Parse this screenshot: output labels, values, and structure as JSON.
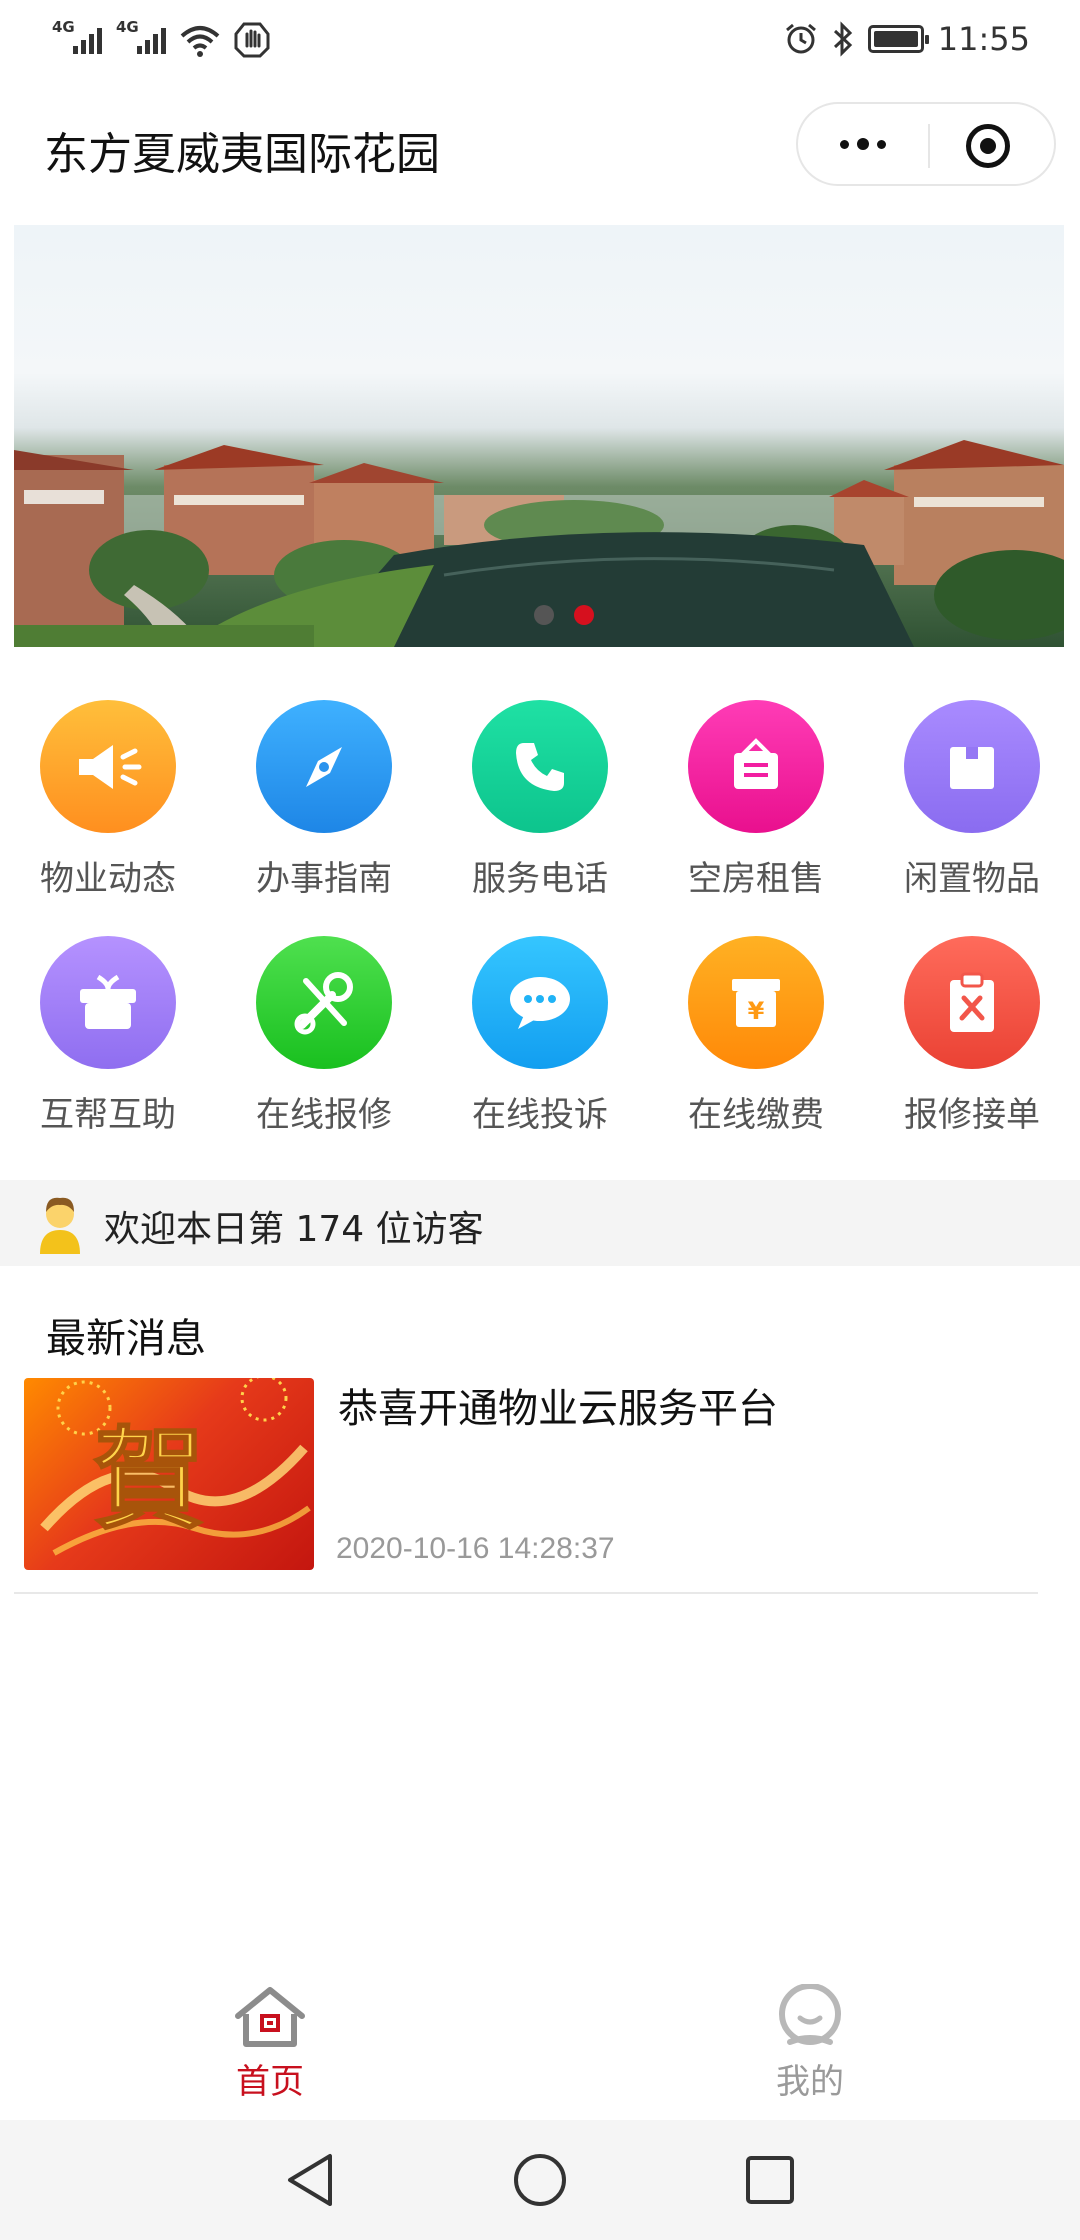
{
  "status_bar": {
    "signal_1_label": "4G",
    "signal_2_label": "4G",
    "time": "11:55",
    "icons": [
      "signal-icon",
      "signal-icon",
      "wifi-icon",
      "hand-icon",
      "alarm-icon",
      "bluetooth-icon",
      "battery-icon"
    ]
  },
  "header": {
    "title": "东方夏威夷国际花园",
    "more_icon": "more-dots-icon",
    "close_icon": "target-icon"
  },
  "banner": {
    "slide_count": 2,
    "active_slide": 2
  },
  "menu": {
    "items": [
      {
        "label": "物业动态",
        "icon": "megaphone-icon",
        "color": "#ffa12b"
      },
      {
        "label": "办事指南",
        "icon": "compass-icon",
        "color": "#2e9bf0"
      },
      {
        "label": "服务电话",
        "icon": "phone-icon",
        "color": "#12d39a"
      },
      {
        "label": "空房租售",
        "icon": "sign-icon",
        "color": "#f21ea1"
      },
      {
        "label": "闲置物品",
        "icon": "box-icon",
        "color": "#9b7cf6"
      },
      {
        "label": "互帮互助",
        "icon": "gift-icon",
        "color": "#a27df2"
      },
      {
        "label": "在线报修",
        "icon": "tools-icon",
        "color": "#2fd339"
      },
      {
        "label": "在线投诉",
        "icon": "chat-icon",
        "color": "#1fb3f6"
      },
      {
        "label": "在线缴费",
        "icon": "yuan-icon",
        "color": "#ff9a14"
      },
      {
        "label": "报修接单",
        "icon": "clipboard-icon",
        "color": "#f2564a"
      }
    ]
  },
  "visitor": {
    "text": "欢迎本日第 174 位访客"
  },
  "news": {
    "section_title": "最新消息",
    "items": [
      {
        "headline": "恭喜开通物业云服务平台",
        "time": "2020-10-16 14:28:37",
        "image_text": "賀"
      }
    ]
  },
  "tabbar": {
    "home_label": "首页",
    "mine_label": "我的",
    "active_color": "#c8101e",
    "inactive_color": "#9a9a9a"
  }
}
